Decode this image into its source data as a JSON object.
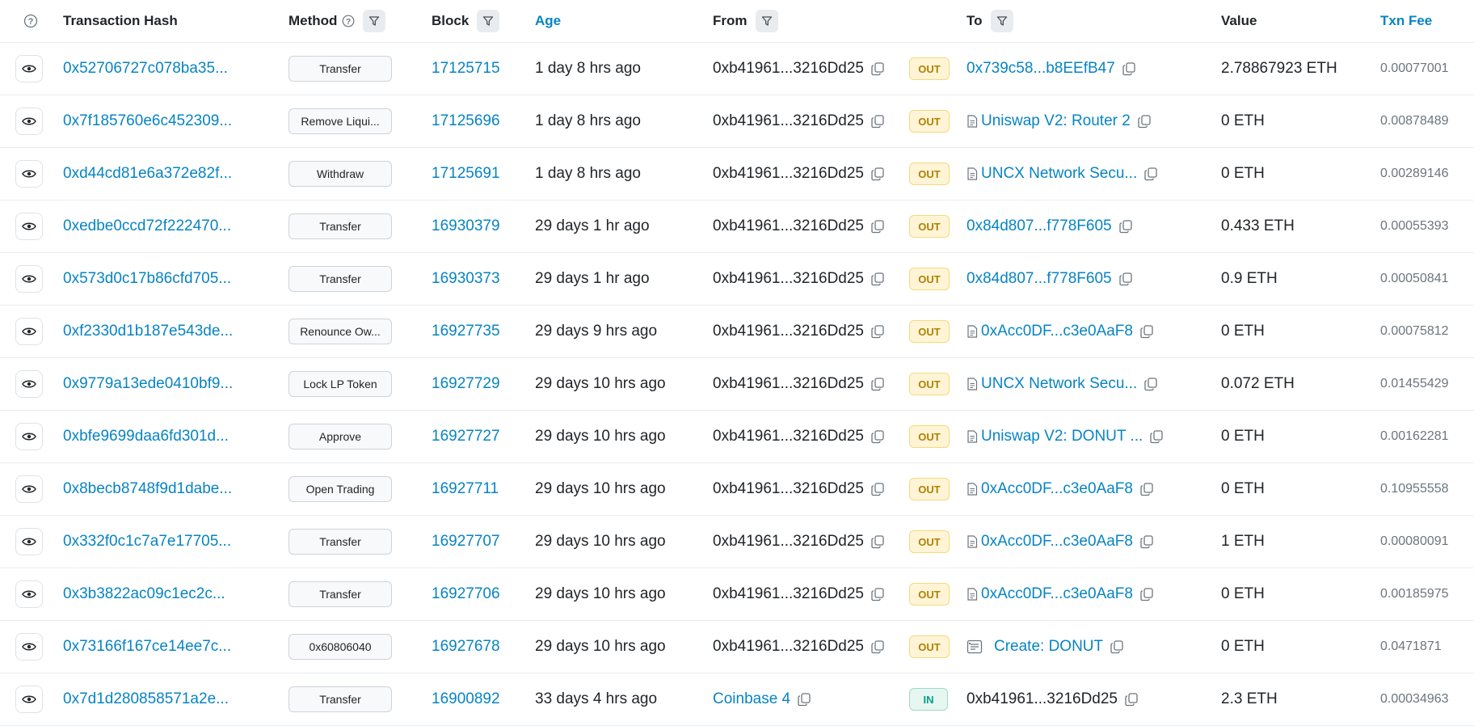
{
  "header": {
    "hash": "Transaction Hash",
    "method": "Method",
    "block": "Block",
    "age": "Age",
    "from": "From",
    "to": "To",
    "value": "Value",
    "fee": "Txn Fee"
  },
  "rows": [
    {
      "hash": "0x52706727c078ba35...",
      "method": "Transfer",
      "block": "17125715",
      "age": "1 day 8 hrs ago",
      "from": "0xb41961...3216Dd25",
      "dir": "OUT",
      "to": "0x739c58...b8EEfB47",
      "to_icon": "",
      "value": "2.78867923 ETH",
      "fee": "0.00077001"
    },
    {
      "hash": "0x7f185760e6c452309...",
      "method": "Remove Liqui...",
      "block": "17125696",
      "age": "1 day 8 hrs ago",
      "from": "0xb41961...3216Dd25",
      "dir": "OUT",
      "to": "Uniswap V2: Router 2",
      "to_icon": "contract",
      "value": "0 ETH",
      "fee": "0.00878489"
    },
    {
      "hash": "0xd44cd81e6a372e82f...",
      "method": "Withdraw",
      "block": "17125691",
      "age": "1 day 8 hrs ago",
      "from": "0xb41961...3216Dd25",
      "dir": "OUT",
      "to": "UNCX Network Secu...",
      "to_icon": "contract",
      "value": "0 ETH",
      "fee": "0.00289146"
    },
    {
      "hash": "0xedbe0ccd72f222470...",
      "method": "Transfer",
      "block": "16930379",
      "age": "29 days 1 hr ago",
      "from": "0xb41961...3216Dd25",
      "dir": "OUT",
      "to": "0x84d807...f778F605",
      "to_icon": "",
      "value": "0.433 ETH",
      "fee": "0.00055393"
    },
    {
      "hash": "0x573d0c17b86cfd705...",
      "method": "Transfer",
      "block": "16930373",
      "age": "29 days 1 hr ago",
      "from": "0xb41961...3216Dd25",
      "dir": "OUT",
      "to": "0x84d807...f778F605",
      "to_icon": "",
      "value": "0.9 ETH",
      "fee": "0.00050841"
    },
    {
      "hash": "0xf2330d1b187e543de...",
      "method": "Renounce Ow...",
      "block": "16927735",
      "age": "29 days 9 hrs ago",
      "from": "0xb41961...3216Dd25",
      "dir": "OUT",
      "to": "0xAcc0DF...c3e0AaF8",
      "to_icon": "contract",
      "value": "0 ETH",
      "fee": "0.00075812"
    },
    {
      "hash": "0x9779a13ede0410bf9...",
      "method": "Lock LP Token",
      "block": "16927729",
      "age": "29 days 10 hrs ago",
      "from": "0xb41961...3216Dd25",
      "dir": "OUT",
      "to": "UNCX Network Secu...",
      "to_icon": "contract",
      "value": "0.072 ETH",
      "fee": "0.01455429"
    },
    {
      "hash": "0xbfe9699daa6fd301d...",
      "method": "Approve",
      "block": "16927727",
      "age": "29 days 10 hrs ago",
      "from": "0xb41961...3216Dd25",
      "dir": "OUT",
      "to": "Uniswap V2: DONUT ...",
      "to_icon": "contract",
      "value": "0 ETH",
      "fee": "0.00162281"
    },
    {
      "hash": "0x8becb8748f9d1dabe...",
      "method": "Open Trading",
      "block": "16927711",
      "age": "29 days 10 hrs ago",
      "from": "0xb41961...3216Dd25",
      "dir": "OUT",
      "to": "0xAcc0DF...c3e0AaF8",
      "to_icon": "contract",
      "value": "0 ETH",
      "fee": "0.10955558"
    },
    {
      "hash": "0x332f0c1c7a7e17705...",
      "method": "Transfer",
      "block": "16927707",
      "age": "29 days 10 hrs ago",
      "from": "0xb41961...3216Dd25",
      "dir": "OUT",
      "to": "0xAcc0DF...c3e0AaF8",
      "to_icon": "contract",
      "value": "1 ETH",
      "fee": "0.00080091"
    },
    {
      "hash": "0x3b3822ac09c1ec2c...",
      "method": "Transfer",
      "block": "16927706",
      "age": "29 days 10 hrs ago",
      "from": "0xb41961...3216Dd25",
      "dir": "OUT",
      "to": "0xAcc0DF...c3e0AaF8",
      "to_icon": "contract",
      "value": "0 ETH",
      "fee": "0.00185975"
    },
    {
      "hash": "0x73166f167ce14ee7c...",
      "method": "0x60806040",
      "block": "16927678",
      "age": "29 days 10 hrs ago",
      "from": "0xb41961...3216Dd25",
      "dir": "OUT",
      "to": "Create: DONUT",
      "to_icon": "create",
      "value": "0 ETH",
      "fee": "0.0471871"
    },
    {
      "hash": "0x7d1d280858571a2e...",
      "method": "Transfer",
      "block": "16900892",
      "age": "33 days 4 hrs ago",
      "from": "Coinbase 4",
      "dir": "IN",
      "to": "0xb41961...3216Dd25",
      "to_icon": "",
      "value": "2.3 ETH",
      "fee": "0.00034963"
    }
  ],
  "colors": {
    "link": "#0784c3",
    "out_bg": "#fff5d6",
    "in_bg": "#e6f6f1"
  },
  "icons": {
    "eye": "eye-icon",
    "copy": "copy-icon",
    "filter": "filter-icon",
    "help": "question-circle-icon",
    "contract": "document-icon",
    "create": "create-contract-icon"
  }
}
